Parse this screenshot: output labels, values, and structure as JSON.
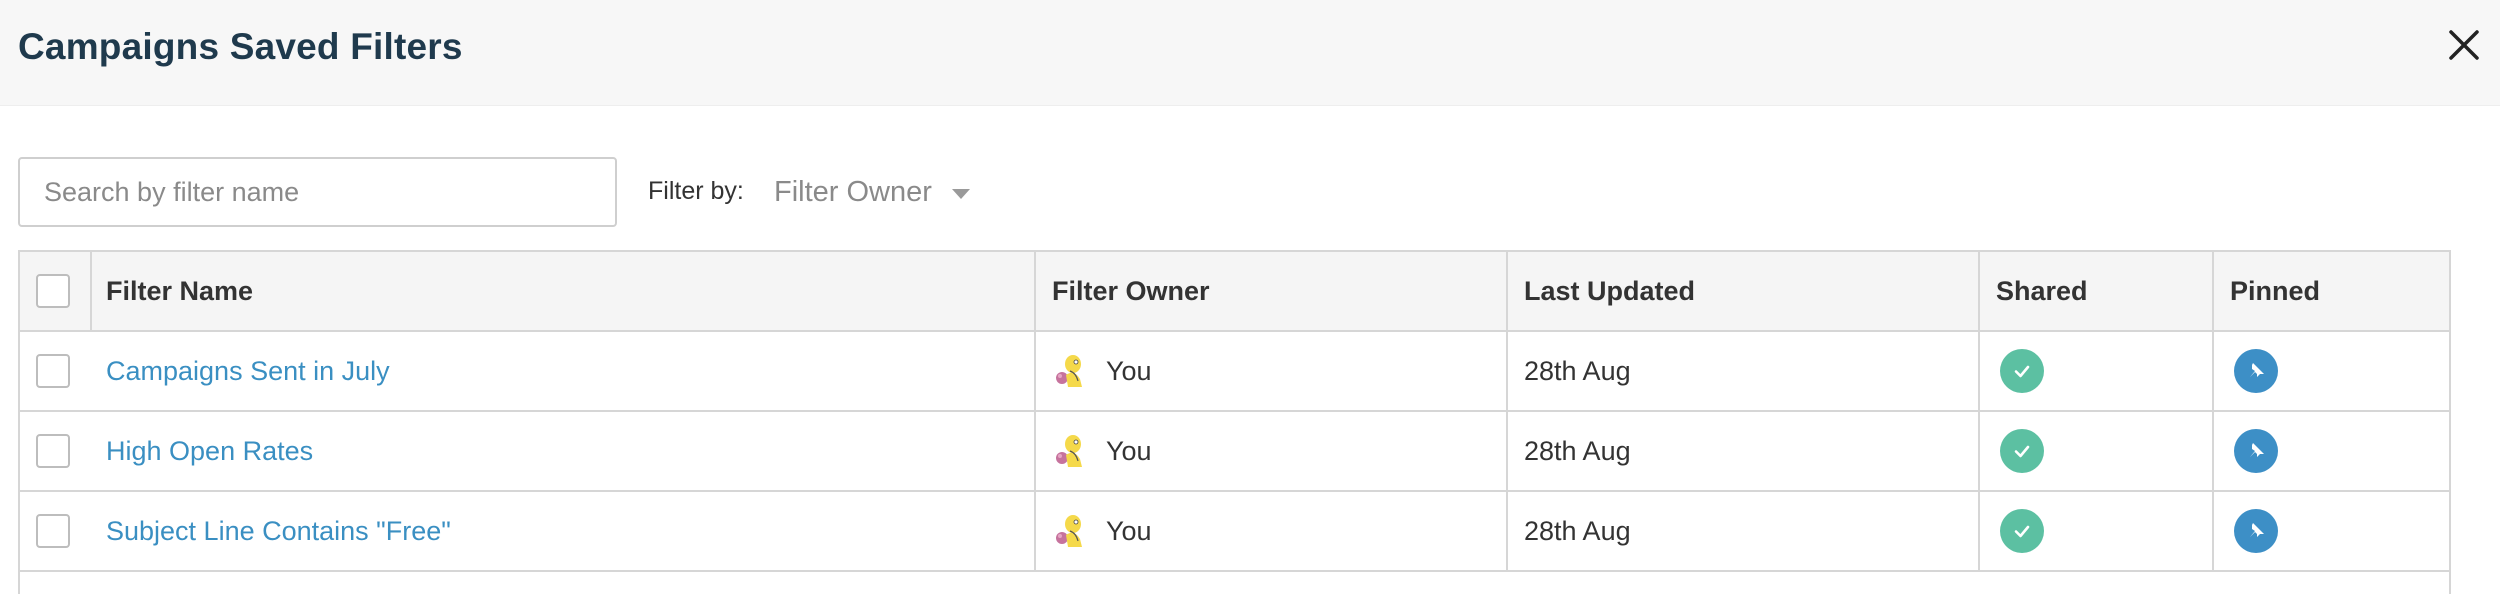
{
  "header": {
    "title": "Campaigns Saved Filters"
  },
  "search": {
    "placeholder": "Search by filter name",
    "value": ""
  },
  "filter": {
    "label": "Filter by:",
    "selected": "Filter Owner"
  },
  "table": {
    "columns": [
      "Filter Name",
      "Filter Owner",
      "Last Updated",
      "Shared",
      "Pinned"
    ],
    "rows": [
      {
        "name": "Campaigns Sent in July",
        "owner": "You",
        "updated": "28th Aug",
        "shared": true,
        "pinned": true
      },
      {
        "name": "High Open Rates",
        "owner": "You",
        "updated": "28th Aug",
        "shared": true,
        "pinned": true
      },
      {
        "name": "Subject Line Contains \"Free\"",
        "owner": "You",
        "updated": "28th Aug",
        "shared": true,
        "pinned": true
      }
    ]
  },
  "colors": {
    "shared": "#5cc0a2",
    "pinned": "#3d8fc6",
    "link": "#3a8fc2",
    "title": "#1f3a4d"
  },
  "icons": {
    "close": "close-icon",
    "shared": "check-icon",
    "pinned": "pin-icon",
    "owner": "user-avatar-icon"
  }
}
